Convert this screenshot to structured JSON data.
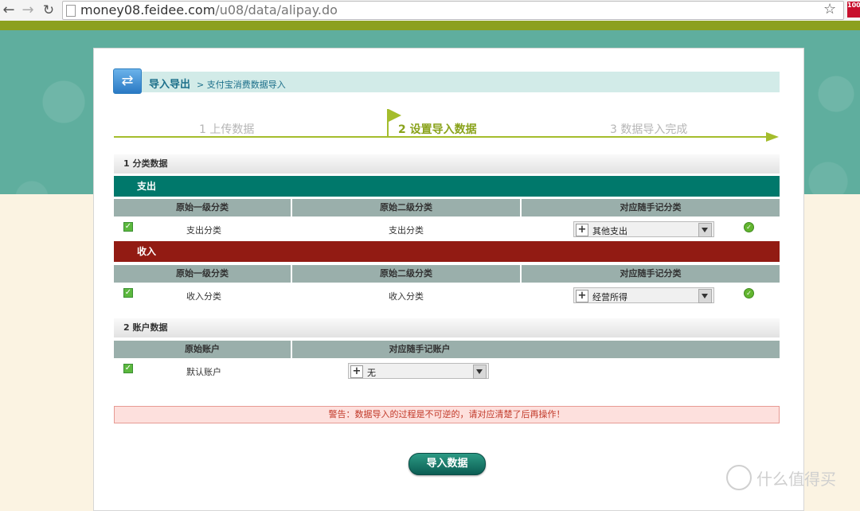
{
  "browser": {
    "url_host": "money08.feidee.com",
    "url_path": "/u08/data/alipay.do",
    "ext_badge": "100"
  },
  "header": {
    "title": "导入导出",
    "breadcrumb": "> 支付宝消费数据导入"
  },
  "steps": [
    {
      "label": "1 上传数据",
      "state": "done"
    },
    {
      "label": "2 设置导入数据",
      "state": "current"
    },
    {
      "label": "3 数据导入完成",
      "state": "pending"
    }
  ],
  "section_category": {
    "title": "1 分类数据",
    "expense": {
      "label": "支出",
      "columns": [
        "原始一级分类",
        "原始二级分类",
        "对应随手记分类"
      ],
      "row": {
        "level1": "支出分类",
        "level2": "支出分类",
        "mapped": "其他支出"
      }
    },
    "income": {
      "label": "收入",
      "columns": [
        "原始一级分类",
        "原始二级分类",
        "对应随手记分类"
      ],
      "row": {
        "level1": "收入分类",
        "level2": "收入分类",
        "mapped": "经营所得"
      }
    }
  },
  "section_account": {
    "title": "2 账户数据",
    "columns": [
      "原始账户",
      "对应随手记账户"
    ],
    "row": {
      "account": "默认账户",
      "mapped": "无"
    }
  },
  "warning": "警告：数据导入的过程是不可逆的，请对应清楚了后再操作！",
  "import_button": "导入数据",
  "watermark": "什么值得买",
  "colors": {
    "expense": "#00786b",
    "income": "#921b13",
    "accent": "#8aa31c"
  }
}
